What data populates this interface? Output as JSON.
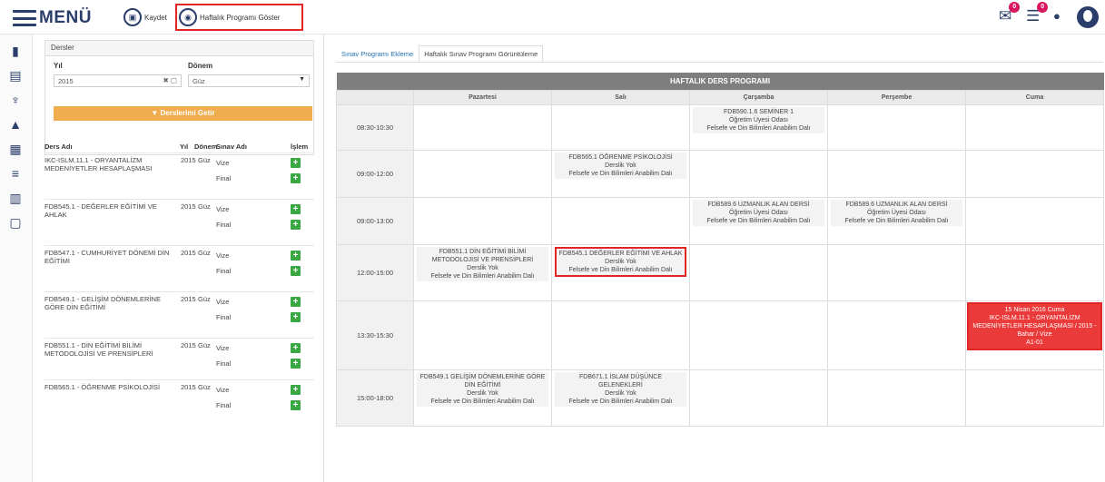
{
  "header": {
    "logo": "MENÜ",
    "save_label": "Kaydet",
    "show_label": "Haftalık Programı Göster",
    "mail_count": "0",
    "list_count": "0"
  },
  "left": {
    "panel_title": "Dersler",
    "year_label": "Yıl",
    "year_value": "2015",
    "term_label": "Dönem",
    "term_value": "Güz",
    "get_button": "▼ Derslerimi Getir",
    "cols": {
      "name": "Ders Adı",
      "year": "Yıl",
      "term": "Dönem",
      "exam": "Sınav Adı",
      "action": "İşlem"
    },
    "courses": [
      {
        "name": "IKC-ISLM.11.1 - ORYANTALİZM MEDENİYETLER HESAPLAŞMASI",
        "year": "2015",
        "term": "Güz",
        "exam1": "Vize",
        "exam2": "Final"
      },
      {
        "name": "FDB545.1 - DEĞERLER EĞİTİMİ VE AHLAK",
        "year": "2015",
        "term": "Güz",
        "exam1": "Vize",
        "exam2": "Final"
      },
      {
        "name": "FDB547.1 - CUMHURİYET DÖNEMİ DİN EĞİTİMİ",
        "year": "2015",
        "term": "Güz",
        "exam1": "Vize",
        "exam2": "Final"
      },
      {
        "name": "FDB549.1 - GELİŞİM DÖNEMLERİNE GÖRE DİN EĞİTİMİ",
        "year": "2015",
        "term": "Güz",
        "exam1": "Vize",
        "exam2": "Final"
      },
      {
        "name": "FDB551.1 - DİN EĞİTİMİ BİLİMİ METODOLOJİSİ VE PRENSİPLERİ",
        "year": "2015",
        "term": "Güz",
        "exam1": "Vize",
        "exam2": "Final"
      },
      {
        "name": "FDB565.1 - ÖĞRENME PSİKOLOJİSİ",
        "year": "2015",
        "term": "Güz",
        "exam1": "Vize",
        "exam2": "Final"
      }
    ]
  },
  "right": {
    "tab1": "Sınav Programı Ekleme",
    "tab2": "Haftalık Sınav Programı Görüntüleme",
    "table_title": "HAFTALIK DERS PROGRAMI",
    "days": [
      "Pazartesi",
      "Salı",
      "Çarşamba",
      "Perşembe",
      "Cuma"
    ],
    "rows": [
      {
        "time": "08:30-10:30",
        "cells": [
          "",
          "",
          "FDB590.1.6 SEMİNER 1\nÖğretim Üyesi Odası\nFelsefe ve Din Bilimleri Anabilim Dalı",
          "",
          ""
        ]
      },
      {
        "time": "09:00-12:00",
        "cells": [
          "",
          "FDB565.1 ÖĞRENME PSİKOLOJİSİ\nDerslik Yok\nFelsefe ve Din Bilimleri Anabilim Dalı",
          "",
          "",
          ""
        ]
      },
      {
        "time": "09:00-13:00",
        "cells": [
          "",
          "",
          "FDB589.6 UZMANLIK ALAN DERSİ\nÖğretim Üyesi Odası\nFelsefe ve Din Bilimleri Anabilim Dalı",
          "FDB589.6 UZMANLIK ALAN DERSİ\nÖğretim Üyesi Odası\nFelsefe ve Din Bilimleri Anabilim Dalı",
          ""
        ]
      },
      {
        "time": "12:00-15:00",
        "cells": [
          "FDB551.1 DİN EĞİTİMİ BİLİMİ METODOLOJİSİ VE PRENSİPLERİ\nDerslik Yok\nFelsefe ve Din Bilimleri Anabilim Dalı",
          "FDB545.1 DEĞERLER EĞİTİMİ VE AHLAK\nDerslik Yok\nFelsefe ve Din Bilimleri Anabilim Dalı",
          "",
          "",
          ""
        ]
      },
      {
        "time": "13:30-15:30",
        "cells": [
          "",
          "",
          "",
          "",
          "15 Nisan 2016 Cuma\nIKC-ISLM.11.1 - ORYANTALİZM MEDENİYETLER HESAPLAŞMASI / 2015 - Bahar / Vize\nA1-01"
        ]
      },
      {
        "time": "15:00-18:00",
        "cells": [
          "FDB549.1 GELİŞİM DÖNEMLERİNE GÖRE DİN EĞİTİMİ\nDerslik Yok\nFelsefe ve Din Bilimleri Anabilim Dalı",
          "FDB671.1 İSLAM DÜŞÜNCE GELENEKLERİ\nDerslik Yok\nFelsefe ve Din Bilimleri Anabilim Dalı",
          "",
          "",
          ""
        ]
      }
    ]
  }
}
